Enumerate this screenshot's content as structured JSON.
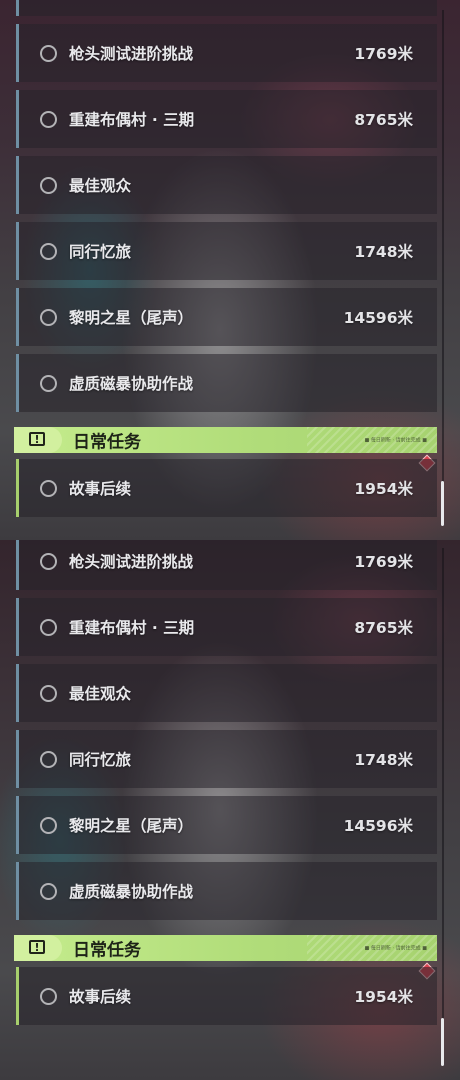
{
  "quests": [
    {
      "title": "枪头测试进阶挑战",
      "distance": "1769米"
    },
    {
      "title": "重建布偶村 · 三期",
      "distance": "8765米"
    },
    {
      "title": "最佳观众",
      "distance": ""
    },
    {
      "title": "同行忆旅",
      "distance": "1748米"
    },
    {
      "title": "黎明之星（尾声）",
      "distance": "14596米"
    },
    {
      "title": "虚质磁暴协助作战",
      "distance": ""
    }
  ],
  "daily_section": {
    "title": "日常任务",
    "icon": "exclamation-icon",
    "tag": "■ 每日刷新 · 请前往完成 ■"
  },
  "daily_quests": [
    {
      "title": "故事后续",
      "distance": "1954米"
    }
  ],
  "colors": {
    "accent_green": "#b1dd7a",
    "quest_bar": "#6f8fa3",
    "marker_red": "#d9424f"
  }
}
